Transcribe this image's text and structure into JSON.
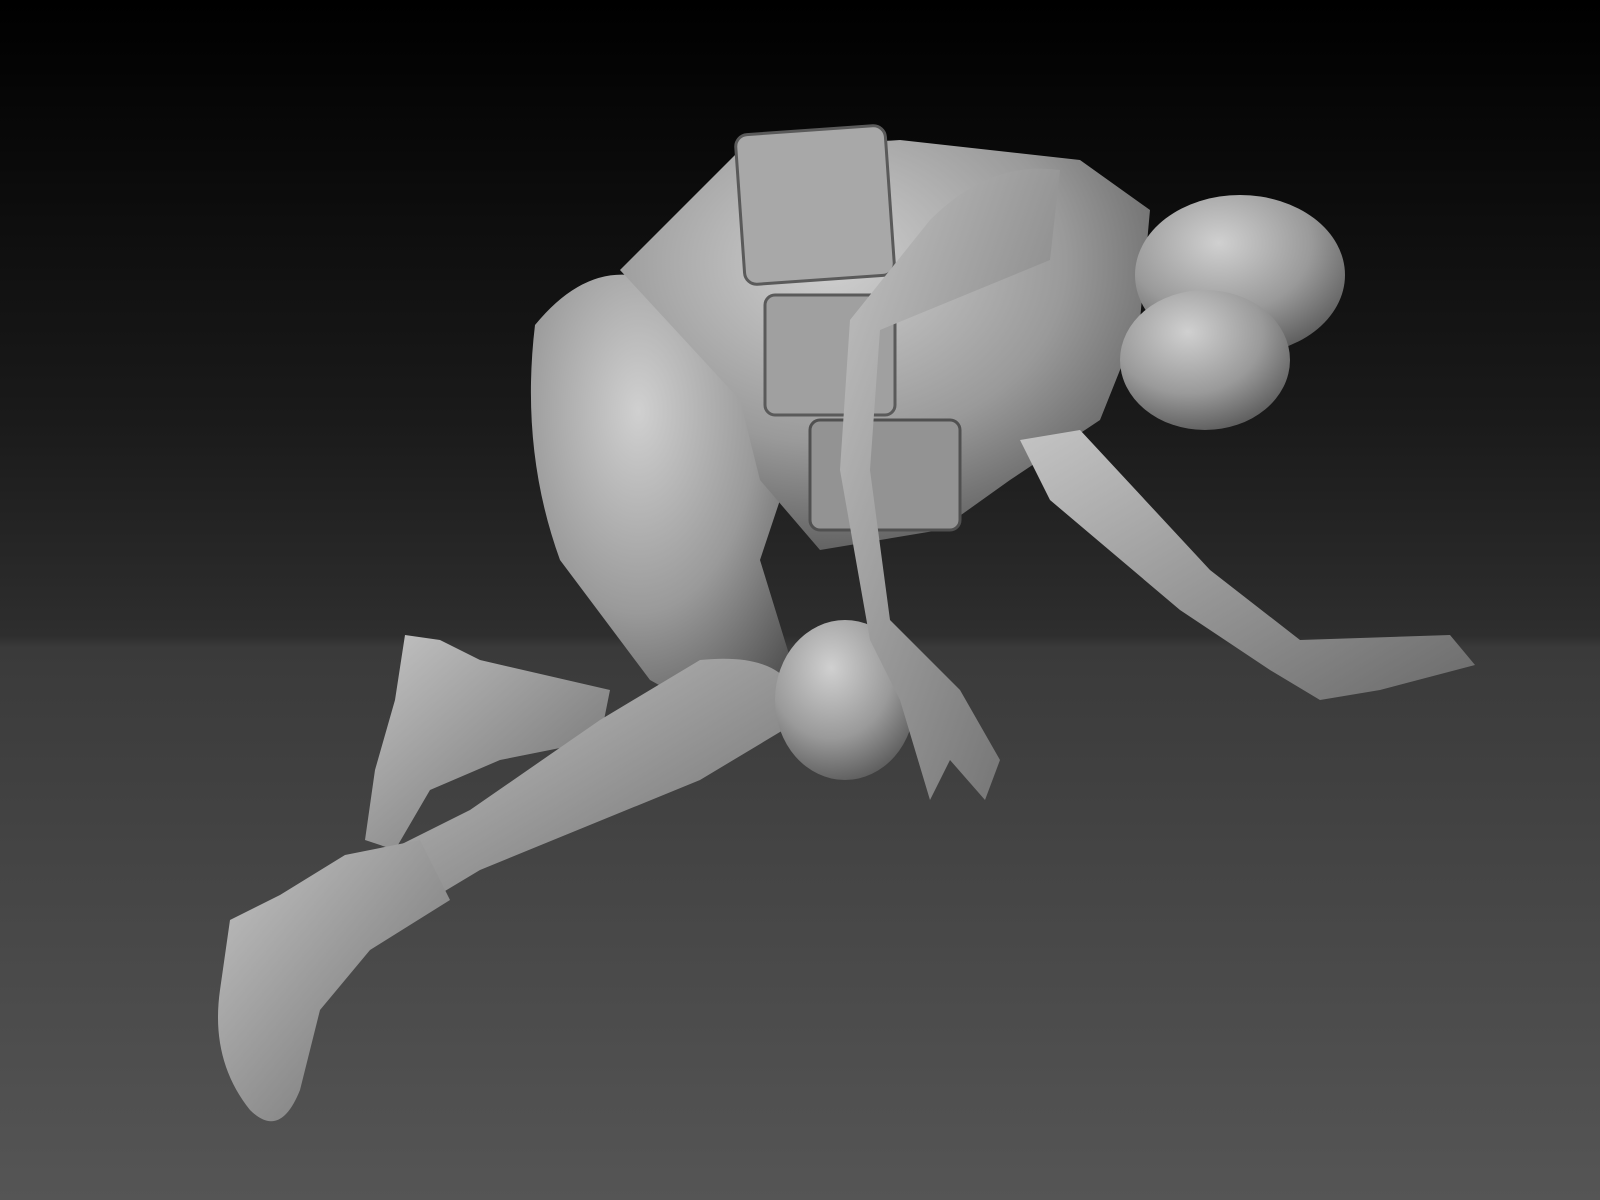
{
  "scene": {
    "subject": "sculpted-figure",
    "colors": {
      "background_top": "#000000",
      "background_bottom": "#555555",
      "material": "#9c9c9c",
      "material_shadow": "#4a4a4a",
      "material_highlight": "#d8d8d8"
    }
  }
}
